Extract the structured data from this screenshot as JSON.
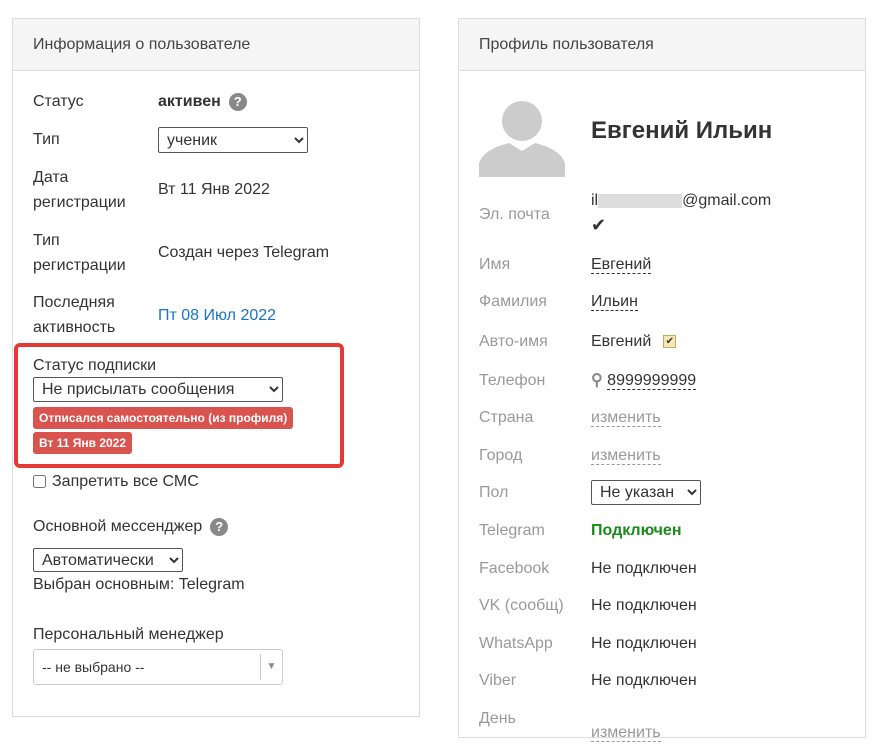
{
  "left": {
    "title": "Информация о пользователе",
    "status_label": "Статус",
    "status_value": "активен",
    "type_label": "Тип",
    "type_value": "ученик",
    "reg_date_label": "Дата регистрации",
    "reg_date_value": "Вт 11 Янв 2022",
    "reg_type_label": "Тип регистрации",
    "reg_type_value": "Создан через Telegram",
    "last_activity_label": "Последняя активность",
    "last_activity_prefix": "Пт ",
    "last_activity_value": "08 Июл 2022",
    "subscription_label": "Статус подписки",
    "subscription_value": "Не присылать сообщения",
    "badge_reason": "Отписался самостоятельно (из профиля)",
    "badge_date": "Вт 11 Янв 2022",
    "sms_label": "Запретить все СМС",
    "messenger_label": "Основной мессенджер",
    "messenger_value": "Автоматически",
    "messenger_chosen": "Выбран основным: Telegram",
    "manager_label": "Персональный менеджер",
    "manager_value": "-- не выбрано --"
  },
  "right": {
    "title": "Профиль пользователя",
    "name": "Евгений Ильин",
    "email_label": "Эл. почта",
    "email_prefix": "il",
    "email_suffix": "@gmail.com",
    "first_label": "Имя",
    "first_value": "Евгений",
    "last_label": "Фамилия",
    "last_value": "Ильин",
    "auto_label": "Авто-имя",
    "auto_value": "Евгений",
    "phone_label": "Телефон",
    "phone_value": "8999999999",
    "country_label": "Страна",
    "country_value": "изменить",
    "city_label": "Город",
    "city_value": "изменить",
    "gender_label": "Пол",
    "gender_value": "Не указан",
    "telegram_label": "Telegram",
    "telegram_value": "Подключен",
    "facebook_label": "Facebook",
    "facebook_value": "Не подключен",
    "vk_label": "VK (сообщ)",
    "vk_value": "Не подключен",
    "whatsapp_label": "WhatsApp",
    "whatsapp_value": "Не подключен",
    "viber_label": "Viber",
    "viber_value": "Не подключен",
    "birthday_label": "День",
    "birthday_value": "изменить"
  },
  "colors": {
    "highlight": "#e53935",
    "badge": "#d9534f",
    "link": "#1a73c4",
    "connected": "#1a8a1a"
  }
}
